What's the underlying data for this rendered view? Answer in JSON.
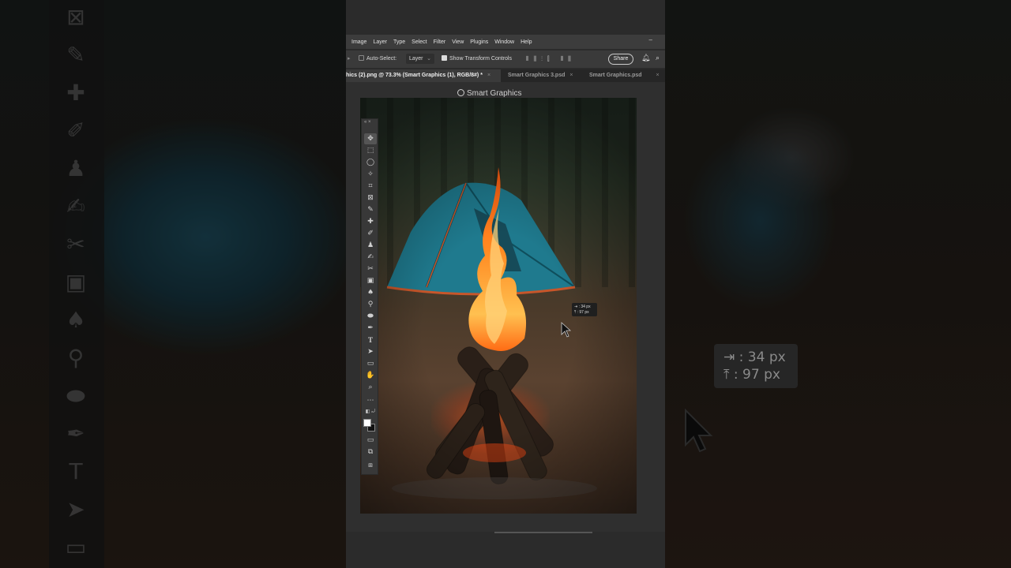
{
  "menu": {
    "items": [
      "Image",
      "Layer",
      "Type",
      "Select",
      "Filter",
      "View",
      "Plugins",
      "Window",
      "Help"
    ],
    "minimize_glyph": "–"
  },
  "options_bar": {
    "auto_select_label": "Auto-Select:",
    "auto_select_checked": false,
    "auto_select_target": "Layer",
    "show_transform_label": "Show Transform Controls",
    "show_transform_checked": true,
    "share_label": "Share"
  },
  "tabs": [
    {
      "label": "hics (2).png @ 73.3% (Smart Graphics (1), RGB/8#) *",
      "active": true,
      "close": "×"
    },
    {
      "label": "Smart Graphics 3.psd",
      "active": false,
      "close": "×"
    },
    {
      "label": "Smart Graphics.psd",
      "active": false,
      "close": "×"
    }
  ],
  "document": {
    "title": "Smart Graphics"
  },
  "readout": {
    "x_label": "⇥ : 34 px",
    "y_label": "⤒ : 97 px"
  },
  "background_readout": {
    "x_label": "⇥ : 34 px",
    "y_label": "⤒ : 97 px"
  },
  "tools_panel": {
    "header": "«  ×",
    "tools": [
      "move-tool",
      "marquee-tool",
      "lasso-tool",
      "magic-wand-tool",
      "crop-tool",
      "frame-tool",
      "eyedropper-tool",
      "healing-brush-tool",
      "brush-tool",
      "clone-stamp-tool",
      "history-brush-tool",
      "eraser-tool",
      "gradient-tool",
      "blur-tool",
      "dodge-tool",
      "burn-tool",
      "pen-tool",
      "type-tool",
      "path-selection-tool",
      "rectangle-tool",
      "hand-tool",
      "zoom-tool",
      "more-tools"
    ]
  },
  "colors": {
    "accent": "#e0e0e0",
    "panel": "#3a3a3a",
    "workspace": "#2f2f2f",
    "fire": "#ff7a1a"
  }
}
